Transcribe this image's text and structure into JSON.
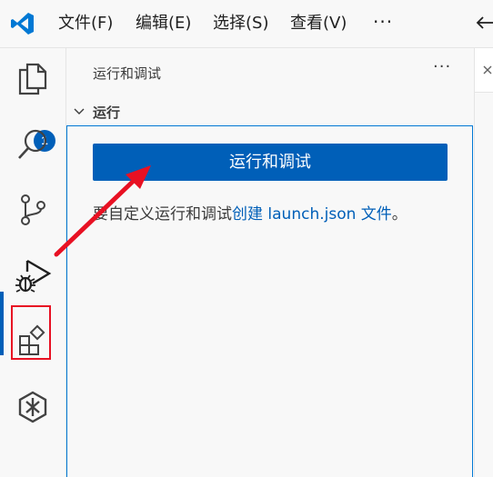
{
  "menu": {
    "file": "文件(F)",
    "edit": "编辑(E)",
    "selection": "选择(S)",
    "view": "查看(V)",
    "more": "···"
  },
  "activity": {
    "explorer_badge": "1"
  },
  "sidebar": {
    "title": "运行和调试",
    "more": "···",
    "section_title": "运行",
    "run_button_label": "运行和调试",
    "hint_prefix": "要自定义运行和调试",
    "hint_link": "创建 launch.json 文件",
    "hint_suffix": "。"
  },
  "colors": {
    "accent": "#005fb8",
    "annotation": "#e81123",
    "vscode_logo": "#0078d4"
  }
}
